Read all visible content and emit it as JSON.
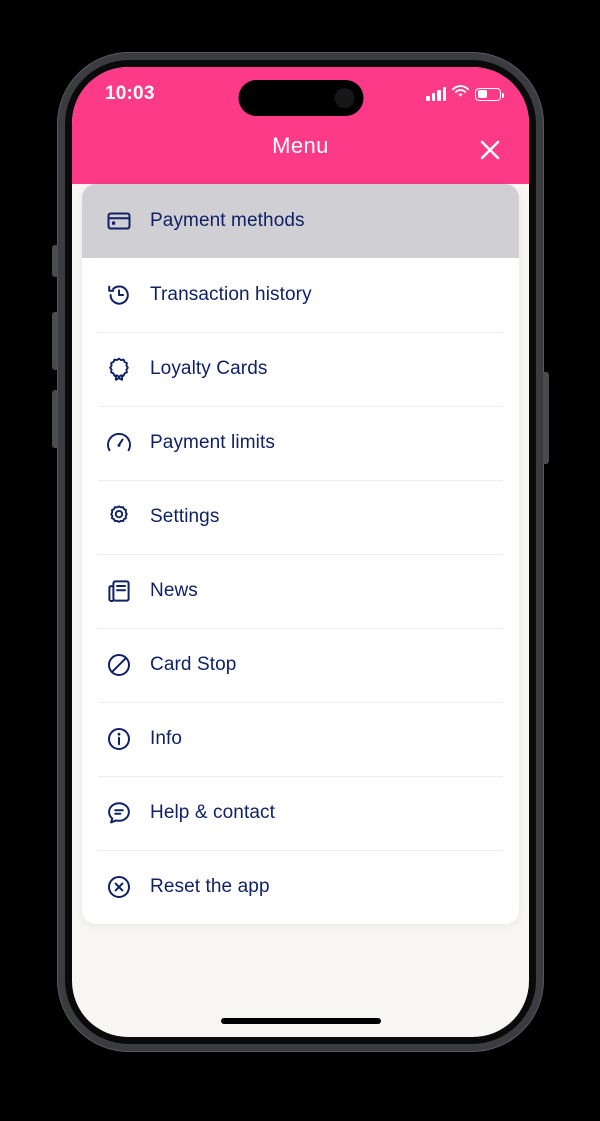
{
  "status_bar": {
    "time": "10:03",
    "signal_icon": "signal-bars-icon",
    "wifi_icon": "wifi-icon",
    "battery_icon": "battery-icon",
    "battery_level_percent": 38
  },
  "header": {
    "title": "Menu",
    "close_icon": "close-icon",
    "background_color": "#FC3A87",
    "title_color": "#FFFFFF"
  },
  "theme": {
    "accent_pink": "#FC3A87",
    "text_navy": "#102265",
    "card_white": "#FFFFFF",
    "selected_gray": "#CFCFD4",
    "screen_background": "#F8F6F2",
    "divider": "#EDEDF0"
  },
  "menu": {
    "items": [
      {
        "label": "Payment methods",
        "icon": "credit-card-icon",
        "selected": true
      },
      {
        "label": "Transaction history",
        "icon": "clock-history-icon",
        "selected": false
      },
      {
        "label": "Loyalty Cards",
        "icon": "award-badge-icon",
        "selected": false
      },
      {
        "label": "Payment limits",
        "icon": "speedometer-icon",
        "selected": false
      },
      {
        "label": "Settings",
        "icon": "gear-icon",
        "selected": false
      },
      {
        "label": "News",
        "icon": "newspaper-icon",
        "selected": false
      },
      {
        "label": "Card Stop",
        "icon": "block-circle-icon",
        "selected": false
      },
      {
        "label": "Info",
        "icon": "info-circle-icon",
        "selected": false
      },
      {
        "label": "Help & contact",
        "icon": "chat-bubble-icon",
        "selected": false
      },
      {
        "label": "Reset the app",
        "icon": "x-circle-icon",
        "selected": false
      }
    ]
  },
  "home_indicator": "home-indicator"
}
